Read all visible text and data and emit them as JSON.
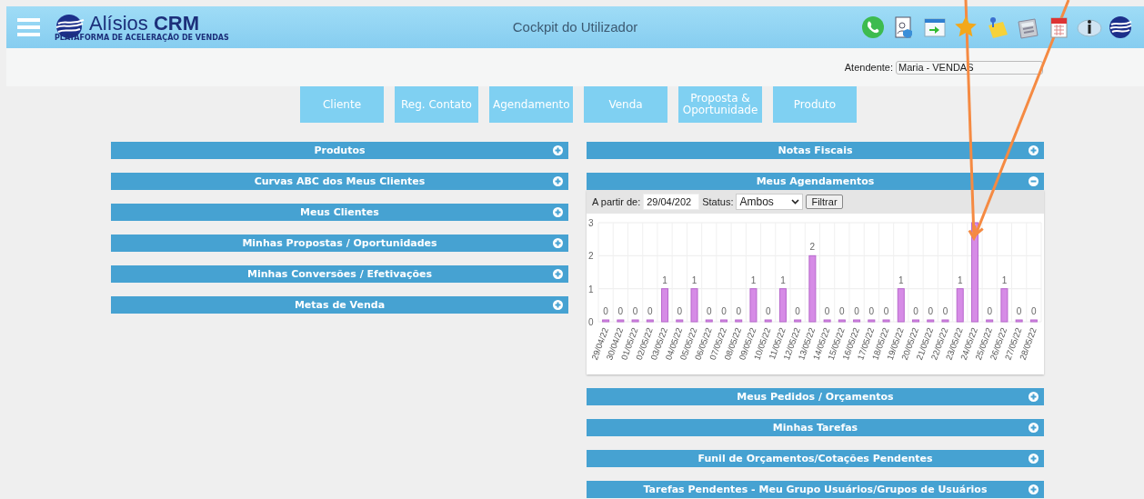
{
  "header": {
    "logo": {
      "name": "Alísios **CRM**",
      "tagline": "PLATAFORMA DE ACELERAÇÃO DE VENDAS"
    },
    "title": "Cockpit do Utilizador",
    "toolbar_icons": [
      {
        "kind": "phone"
      },
      {
        "kind": "user-document"
      },
      {
        "kind": "window-arrow"
      },
      {
        "kind": "star"
      },
      {
        "kind": "sticky-note"
      },
      {
        "kind": "calculator"
      },
      {
        "kind": "calendar"
      },
      {
        "kind": "info"
      },
      {
        "kind": "logo"
      }
    ]
  },
  "attendant": {
    "label": "Atendente:",
    "value": "Maria - VENDAS"
  },
  "nav_buttons": [
    "Cliente",
    "Reg. Contato",
    "Agendamento",
    "Venda",
    "Proposta & Oportunidade",
    "Produto"
  ],
  "left_panels": [
    {
      "title": "Produtos",
      "expanded": false
    },
    {
      "title": "Curvas ABC dos Meus Clientes",
      "expanded": false
    },
    {
      "title": "Meus Clientes",
      "expanded": false
    },
    {
      "title": "Minhas Propostas / Oportunidades",
      "expanded": false
    },
    {
      "title": "Minhas Conversões / Efetivações",
      "expanded": false
    },
    {
      "title": "Metas de Venda",
      "expanded": false
    }
  ],
  "right_panels": [
    {
      "title": "Notas Fiscais",
      "expanded": false
    },
    {
      "title": "Meus Agendamentos",
      "expanded": true,
      "filter": {
        "date_label": "A partir de:",
        "date_value": "29/04/202",
        "status_label": "Status:",
        "status_value": "Ambos",
        "button": "Filtrar"
      },
      "chart_data": {
        "type": "bar",
        "categories": [
          "29/04/22",
          "30/04/22",
          "01/05/22",
          "02/05/22",
          "03/05/22",
          "04/05/22",
          "05/05/22",
          "06/05/22",
          "07/05/22",
          "08/05/22",
          "09/05/22",
          "10/05/22",
          "11/05/22",
          "12/05/22",
          "13/05/22",
          "14/05/22",
          "15/05/22",
          "16/05/22",
          "17/05/22",
          "18/05/22",
          "19/05/22",
          "20/05/22",
          "21/05/22",
          "22/05/22",
          "23/05/22",
          "24/05/22",
          "25/05/22",
          "26/05/22",
          "27/05/22",
          "28/05/22"
        ],
        "values": [
          0,
          0,
          0,
          0,
          1,
          0,
          1,
          0,
          0,
          0,
          1,
          0,
          1,
          0,
          2,
          0,
          0,
          0,
          0,
          0,
          1,
          0,
          0,
          0,
          1,
          3,
          0,
          1,
          0,
          0
        ],
        "value_labels": [
          "0",
          "0",
          "0",
          "0",
          "1",
          "0",
          "1",
          "0",
          "0",
          "0",
          "1",
          "0",
          "1",
          "0",
          "2",
          "0",
          "0",
          "0",
          "0",
          "0",
          "1",
          "0",
          "0",
          "0",
          "1",
          null,
          "0",
          "1",
          "0",
          "0"
        ],
        "ylim": [
          0,
          3
        ],
        "yticks": [
          0,
          1,
          2,
          3
        ]
      }
    },
    {
      "title": "Meus Pedidos / Orçamentos",
      "expanded": false
    },
    {
      "title": "Minhas Tarefas",
      "expanded": false
    },
    {
      "title": "Funil de Orçamentos/Cotações Pendentes",
      "expanded": false
    },
    {
      "title": "Tarefas Pendentes - Meu Grupo Usuários/Grupos de Usuários",
      "expanded": false
    }
  ],
  "annotation_arrows": [
    {
      "kind": "arrow"
    },
    {
      "kind": "arrow"
    }
  ]
}
